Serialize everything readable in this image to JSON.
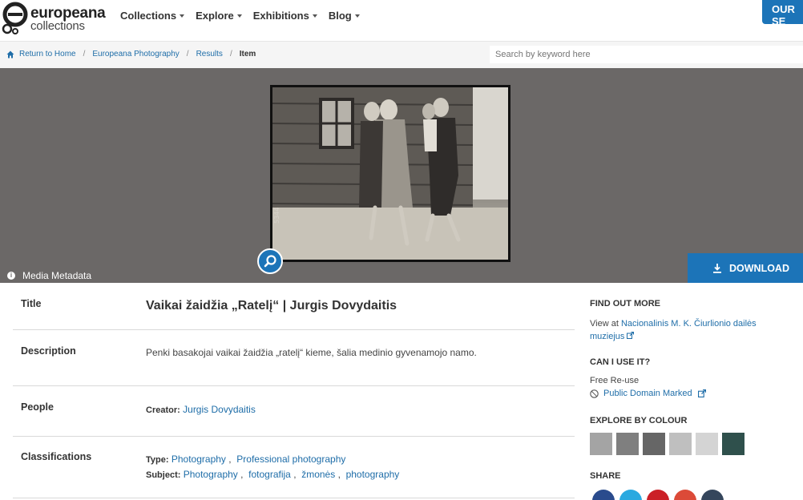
{
  "header": {
    "logo_line1": "europeana",
    "logo_line2": "collections",
    "nav": [
      "Collections",
      "Explore",
      "Exhibitions",
      "Blog"
    ],
    "our_button": "OUR SE"
  },
  "breadcrumb": {
    "items": [
      "Return to Home",
      "Europeana Photography",
      "Results"
    ],
    "current": "Item"
  },
  "search": {
    "placeholder": "Search by keyword here"
  },
  "media": {
    "metadata_label": "Media Metadata",
    "download_label": "DOWNLOAD",
    "photo_edge_text": "5344"
  },
  "item": {
    "title_label": "Title",
    "title": "Vaikai žaidžia „Ratelį“ | Jurgis Dovydaitis",
    "description_label": "Description",
    "description": "Penki basakojai vaikai žaidžia „ratelį“ kieme, šalia medinio gyvenamojo namo.",
    "people_label": "People",
    "creator_label": "Creator:",
    "creator": "Jurgis Dovydaitis",
    "classifications_label": "Classifications",
    "type_label": "Type:",
    "types": [
      "Photography",
      "Professional photography"
    ],
    "subject_label": "Subject:",
    "subjects": [
      "Photography",
      "fotografija",
      "žmonės",
      "photography"
    ]
  },
  "sidebar": {
    "find_out_more": "FIND OUT MORE",
    "view_at": "View at",
    "institution_line1": "Nacionalinis M. K. Čiurlionio dailės",
    "institution_line2": "muziejus",
    "can_i_use": "CAN I USE IT?",
    "free_reuse": "Free Re-use",
    "license": "Public Domain Marked",
    "explore_colour": "EXPLORE BY COLOUR",
    "colours": [
      "#a4a4a4",
      "#7f7f7f",
      "#666666",
      "#bfbfbf",
      "#d4d4d4",
      "#2f504c"
    ],
    "share": "SHARE",
    "share_colors": [
      "#2a4b8d",
      "#2aa9e0",
      "#cb2027",
      "#dc4a38",
      "#35465c"
    ]
  }
}
